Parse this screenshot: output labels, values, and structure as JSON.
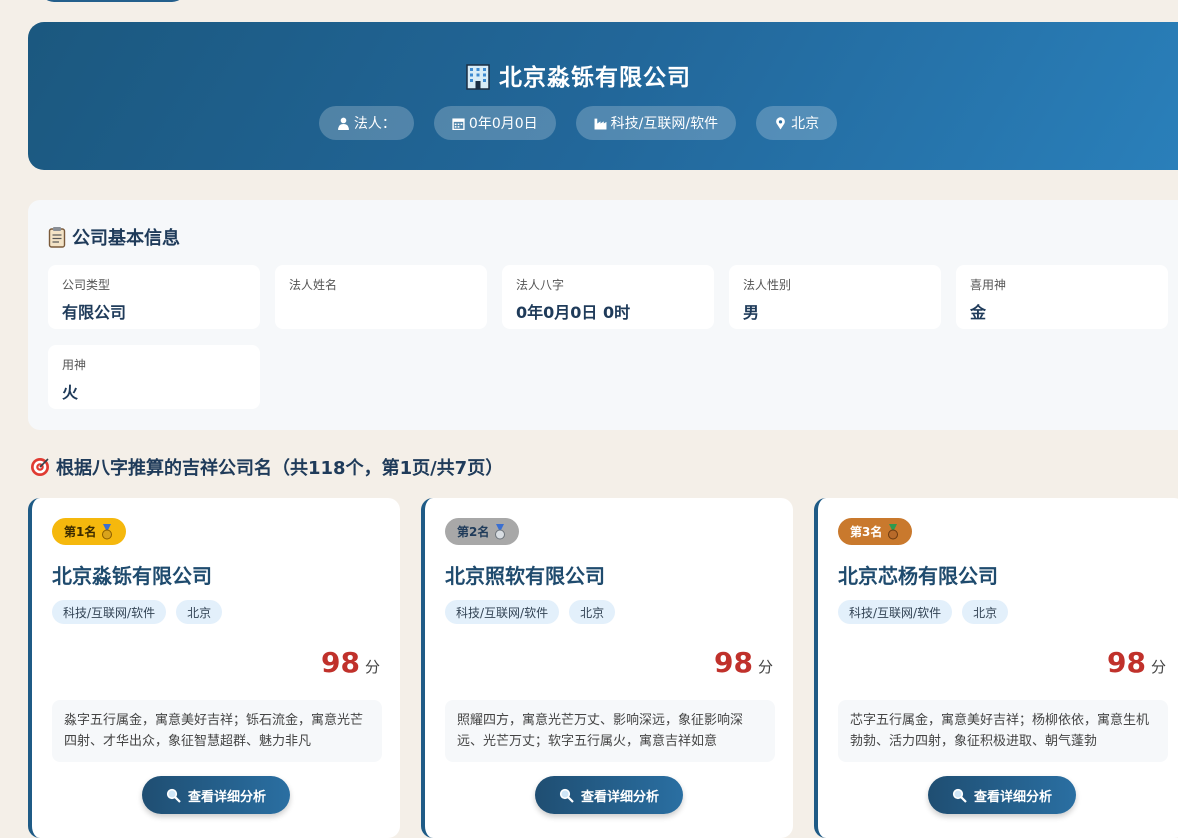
{
  "hero": {
    "title": "北京淼铄有限公司",
    "chips": {
      "legal_person": "法人：",
      "date": "0年0月0日",
      "industry": "科技/互联网/软件",
      "location": "北京"
    }
  },
  "basic_info": {
    "title": "公司基本信息",
    "fields": [
      {
        "label": "公司类型",
        "value": "有限公司"
      },
      {
        "label": "法人姓名",
        "value": ""
      },
      {
        "label": "法人八字",
        "value": "0年0月0日 0时"
      },
      {
        "label": "法人性别",
        "value": "男"
      },
      {
        "label": "喜用神",
        "value": "金"
      },
      {
        "label": "用神",
        "value": "火"
      }
    ]
  },
  "results": {
    "title": "根据八字推算的吉祥公司名（共118个，第1页/共7页）",
    "cards": [
      {
        "rank": "第1名",
        "name": "北京淼铄有限公司",
        "tags": [
          "科技/互联网/软件",
          "北京"
        ],
        "score": "98",
        "score_unit": "分",
        "desc": "淼字五行属金，寓意美好吉祥；铄石流金，寓意光芒四射、才华出众，象征智慧超群、魅力非凡",
        "button": "查看详细分析",
        "rank_color": "#f5b80d"
      },
      {
        "rank": "第2名",
        "name": "北京照软有限公司",
        "tags": [
          "科技/互联网/软件",
          "北京"
        ],
        "score": "98",
        "score_unit": "分",
        "desc": "照耀四方，寓意光芒万丈、影响深远，象征影响深远、光芒万丈；软字五行属火，寓意吉祥如意",
        "button": "查看详细分析",
        "rank_color": "#a8a8a8"
      },
      {
        "rank": "第3名",
        "name": "北京芯杨有限公司",
        "tags": [
          "科技/互联网/软件",
          "北京"
        ],
        "score": "98",
        "score_unit": "分",
        "desc": "芯字五行属金，寓意美好吉祥；杨柳依依，寓意生机勃勃、活力四射，象征积极进取、朝气蓬勃",
        "button": "查看详细分析",
        "rank_color": "#c9792d"
      }
    ]
  }
}
